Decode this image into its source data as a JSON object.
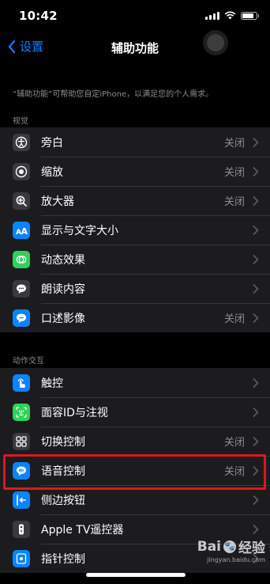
{
  "status_bar": {
    "time": "10:42",
    "battery_level": 0.85
  },
  "nav": {
    "back_label": "设置",
    "title": "辅助功能"
  },
  "description": "“辅助功能”可帮助您自定iPhone，以满足您的个人需求。",
  "sections": [
    {
      "header": "视觉",
      "rows": [
        {
          "label": "旁白",
          "value": "关闭",
          "icon": "voiceover-icon",
          "color": "#3a3a3c"
        },
        {
          "label": "缩放",
          "value": "关闭",
          "icon": "zoom-icon",
          "color": "#3a3a3c"
        },
        {
          "label": "放大器",
          "value": "关闭",
          "icon": "magnifier-icon",
          "color": "#3a3a3c"
        },
        {
          "label": "显示与文字大小",
          "value": "",
          "icon": "text-size-icon",
          "color": "#0a84ff"
        },
        {
          "label": "动态效果",
          "value": "",
          "icon": "motion-icon",
          "color": "#30d158"
        },
        {
          "label": "朗读内容",
          "value": "",
          "icon": "speech-bubble-icon",
          "color": "#3a3a3c"
        },
        {
          "label": "口述影像",
          "value": "关闭",
          "icon": "audio-description-icon",
          "color": "#0a84ff"
        }
      ]
    },
    {
      "header": "动作交互",
      "rows": [
        {
          "label": "触控",
          "value": "",
          "icon": "touch-icon",
          "color": "#0a84ff"
        },
        {
          "label": "面容ID与注视",
          "value": "",
          "icon": "face-id-icon",
          "color": "#30d158"
        },
        {
          "label": "切换控制",
          "value": "关闭",
          "icon": "switch-control-icon",
          "color": "#3a3a3c"
        },
        {
          "label": "语音控制",
          "value": "关闭",
          "icon": "voice-control-icon",
          "color": "#0a84ff"
        },
        {
          "label": "侧边按钮",
          "value": "",
          "icon": "side-button-icon",
          "color": "#0a84ff"
        },
        {
          "label": "Apple TV遥控器",
          "value": "",
          "icon": "remote-icon",
          "color": "#3a3a3c"
        },
        {
          "label": "指针控制",
          "value": "",
          "icon": "pointer-icon",
          "color": "#0a84ff"
        }
      ]
    }
  ],
  "watermark": {
    "logo_text": "Bai",
    "logo_text2": "经验",
    "url": "jingyan.baidu.com"
  }
}
